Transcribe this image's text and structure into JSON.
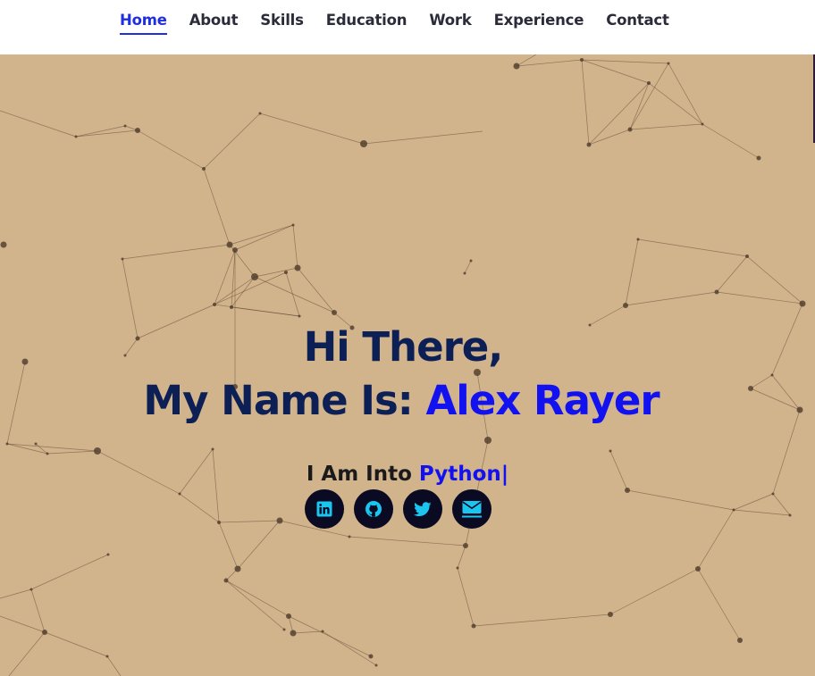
{
  "nav": {
    "items": [
      {
        "label": "Home",
        "active": true
      },
      {
        "label": "About",
        "active": false
      },
      {
        "label": "Skills",
        "active": false
      },
      {
        "label": "Education",
        "active": false
      },
      {
        "label": "Work",
        "active": false
      },
      {
        "label": "Experience",
        "active": false
      },
      {
        "label": "Contact",
        "active": false
      }
    ]
  },
  "hero": {
    "greeting": "Hi There,",
    "name_prefix": "My Name Is:",
    "name": "Alex Rayer",
    "typed_prefix": "I Am Into",
    "typed_value": "Python|",
    "background_color": "#d1b38c",
    "heading_color": "#0c2055",
    "accent_color": "#1212f0"
  },
  "socials": [
    {
      "icon": "linkedin-icon"
    },
    {
      "icon": "github-icon"
    },
    {
      "icon": "twitter-icon"
    },
    {
      "icon": "mail-icon"
    }
  ]
}
